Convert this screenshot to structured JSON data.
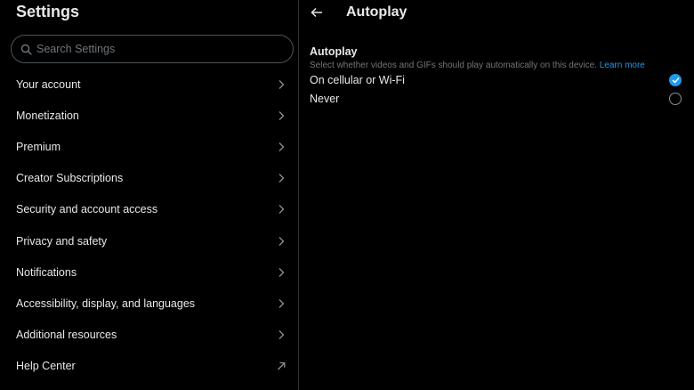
{
  "sidebar": {
    "title": "Settings",
    "search": {
      "placeholder": "Search Settings",
      "value": ""
    },
    "items": [
      {
        "label": "Your account",
        "icon": "chevron-right-icon"
      },
      {
        "label": "Monetization",
        "icon": "chevron-right-icon"
      },
      {
        "label": "Premium",
        "icon": "chevron-right-icon"
      },
      {
        "label": "Creator Subscriptions",
        "icon": "chevron-right-icon"
      },
      {
        "label": "Security and account access",
        "icon": "chevron-right-icon"
      },
      {
        "label": "Privacy and safety",
        "icon": "chevron-right-icon"
      },
      {
        "label": "Notifications",
        "icon": "chevron-right-icon"
      },
      {
        "label": "Accessibility, display, and languages",
        "icon": "chevron-right-icon"
      },
      {
        "label": "Additional resources",
        "icon": "chevron-right-icon"
      },
      {
        "label": "Help Center",
        "icon": "external-link-icon"
      }
    ]
  },
  "detail": {
    "title": "Autoplay",
    "section_title": "Autoplay",
    "description": "Select whether videos and GIFs should play automatically on this device.",
    "learn_more": "Learn more",
    "options": [
      {
        "label": "On cellular or Wi-Fi",
        "selected": true
      },
      {
        "label": "Never",
        "selected": false
      }
    ]
  },
  "colors": {
    "background": "#000000",
    "text": "#e7e9ea",
    "muted": "#71767b",
    "accent": "#1d9bf0",
    "divider": "#2f3336"
  }
}
